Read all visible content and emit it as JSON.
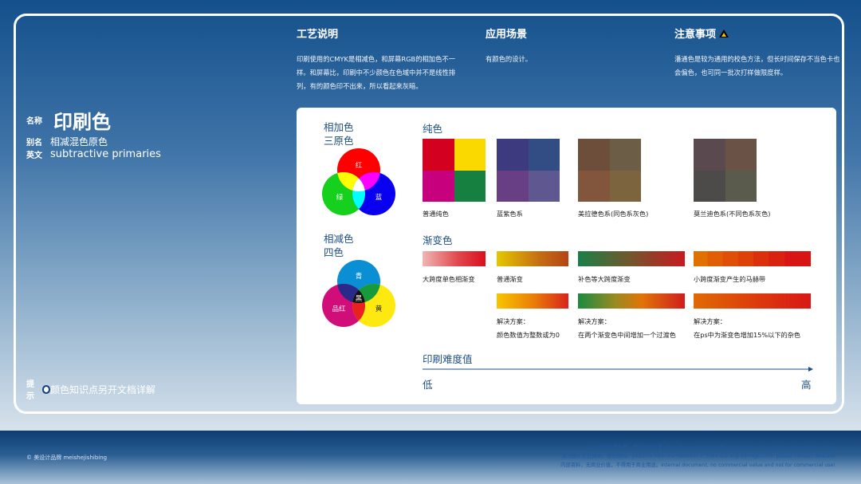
{
  "process": {
    "title": "工艺说明",
    "desc": "印刷使用的CMYK是相减色，和屏幕RGB的相加色不一样。和屏幕比，印刷中不少颜色在色域中并不是线性排列，有的颜色印不出来，所以看起来灰暗。"
  },
  "scene": {
    "title": "应用场景",
    "desc": "有颜色的设计。"
  },
  "caution": {
    "title": "注意事项",
    "desc": "潘通色是较为通用的校色方法，但长时间保存不当色卡也会偏色，也可同一批次打样做限度样。"
  },
  "left": {
    "name_tag": "名称",
    "name": "印刷色",
    "alias_tag": "别名",
    "alias": "相减混色原色",
    "en_tag": "英文",
    "en": "subtractive primaries",
    "note_tag": "提示",
    "note": "颜色知识点另开文档详解"
  },
  "additive": {
    "title_1": "相加色",
    "title_2": "三原色",
    "red": "红",
    "green": "绿",
    "blue": "蓝"
  },
  "subtractive": {
    "title_1": "相减色",
    "title_2": "四色",
    "cyan": "青",
    "magenta": "品红",
    "yellow": "黄",
    "black": "黑"
  },
  "pure": {
    "title": "纯色",
    "groups": [
      {
        "label": "普通纯色",
        "colors": [
          "#d4001f",
          "#f9d900",
          "#c7007e",
          "#15803f"
        ]
      },
      {
        "label": "蓝紫色系",
        "colors": [
          "#3e3a80",
          "#324d83",
          "#683f84",
          "#5e5790"
        ]
      },
      {
        "label": "美拉德色系(同色系灰色)",
        "colors": [
          "#6d4e3a",
          "#6c5d46",
          "#82563c",
          "#7c643f"
        ]
      },
      {
        "label": "莫兰迪色系(不同色系灰色)",
        "colors": [
          "#5a4a4f",
          "#6b5247",
          "#4d4b4a",
          "#5a5b4d"
        ]
      }
    ]
  },
  "gradient": {
    "title": "渐变色",
    "labels": [
      "大跨度单色相渐变",
      "普通渐变",
      "补色等大跨度渐变",
      "小跨度渐变产生的马赫带"
    ],
    "solution_title": "解决方案：",
    "solutions": [
      "颜色数值为整数或为0",
      "在两个渐变色中间增加一个过渡色",
      "在ps中为渐变色增加15%以下的杂色"
    ]
  },
  "difficulty": {
    "title": "印刷难度值",
    "low": "低",
    "high": "高"
  },
  "footer": {
    "brand": "© 美设计品牌 meishejishibing",
    "disclaimer_1": "以上内容仅供参考，请以实际为准。the above content is for reference only and can vary case by case.",
    "disclaimer_2": "部分图片来自网络，侵权删除。pictures from the network, if there are any infringement, please contact deleted!",
    "disclaimer_3": "内部资料，无商业价值，不得用于商业用途。internal document, no commercial value and not for commercial use!"
  },
  "colors": {
    "accent": "#1f4f86",
    "frame": "#ffffff"
  }
}
